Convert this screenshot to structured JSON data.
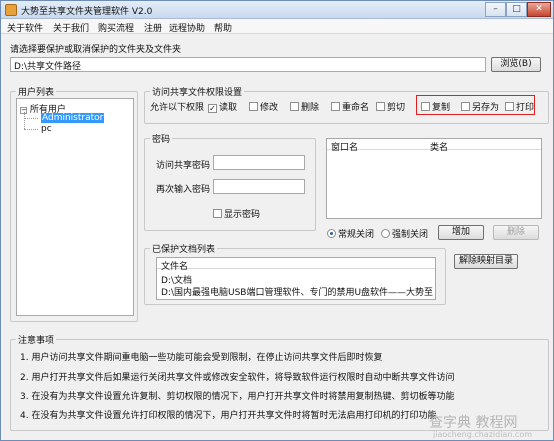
{
  "window": {
    "title": "大势至共享文件夹管理软件 V2.0",
    "buttons": {
      "minimize": "–",
      "maximize": "□",
      "close": "✕"
    }
  },
  "menu": [
    "关于软件",
    "关于我们",
    "购买流程",
    "注册",
    "远程协助",
    "帮助"
  ],
  "folder": {
    "prompt": "请选择要保护或取消保护的文件夹及文件夹",
    "path_value": "D:\\共享文件路径",
    "browse_label": "浏览(B)"
  },
  "users": {
    "group_title": "用户列表",
    "root": "所有用户",
    "items": [
      "Administrator",
      "pc"
    ],
    "expand_glyph": "−"
  },
  "permissions": {
    "group_title": "访问共享文件权限设置",
    "allow_label": "允许以下权限",
    "items": [
      {
        "label": "读取",
        "checked": true
      },
      {
        "label": "修改",
        "checked": false
      },
      {
        "label": "删除",
        "checked": false
      },
      {
        "label": "重命名",
        "checked": false
      },
      {
        "label": "剪切",
        "checked": false
      },
      {
        "label": "复制",
        "checked": false
      },
      {
        "label": "另存为",
        "checked": false
      },
      {
        "label": "打印",
        "checked": false
      }
    ],
    "check_glyph": "✓",
    "highlight_color": "#e02020"
  },
  "password": {
    "group_title": "密码",
    "access_label": "访问共享密码",
    "confirm_label": "再次输入密码",
    "access_value": "",
    "confirm_value": "",
    "show_label": "显示密码"
  },
  "process_list": {
    "columns": [
      "窗口名",
      "类名"
    ],
    "mode_options": [
      {
        "label": "常规关闭",
        "selected": true
      },
      {
        "label": "强制关闭",
        "selected": false
      }
    ],
    "add_label": "增加",
    "delete_label": "删除"
  },
  "protected": {
    "group_title": "已保护文档列表",
    "column": "文件名",
    "items": [
      "D:\\文档",
      "D:\\国内最强电脑USB端口管理软件、专门的禁用U盘软件——大势至USB端..."
    ],
    "remove_label": "解除映射目录"
  },
  "notes": {
    "title": "注意事项",
    "items": [
      "1. 用户访问共享文件期间重电脑一些功能可能会受到限制，在停止访问共享文件后即时恢复",
      "2. 用户打开共享文件后如果运行关闭共享文件或修改安全软件，将导致软件运行权限时自动中断共享文件访问",
      "3. 在没有为共享文件设置允许复制、剪切权限的情况下，用户打开共享文件时将禁用复制热键、剪切板等功能",
      "4. 在没有为共享文件设置允许打印权限的情况下，用户打开共享文件时将暂时无法启用打印机的打印功能"
    ]
  },
  "watermark": {
    "main": "查字典 教程网",
    "sub": "jiaocheng.chazidian.com"
  }
}
